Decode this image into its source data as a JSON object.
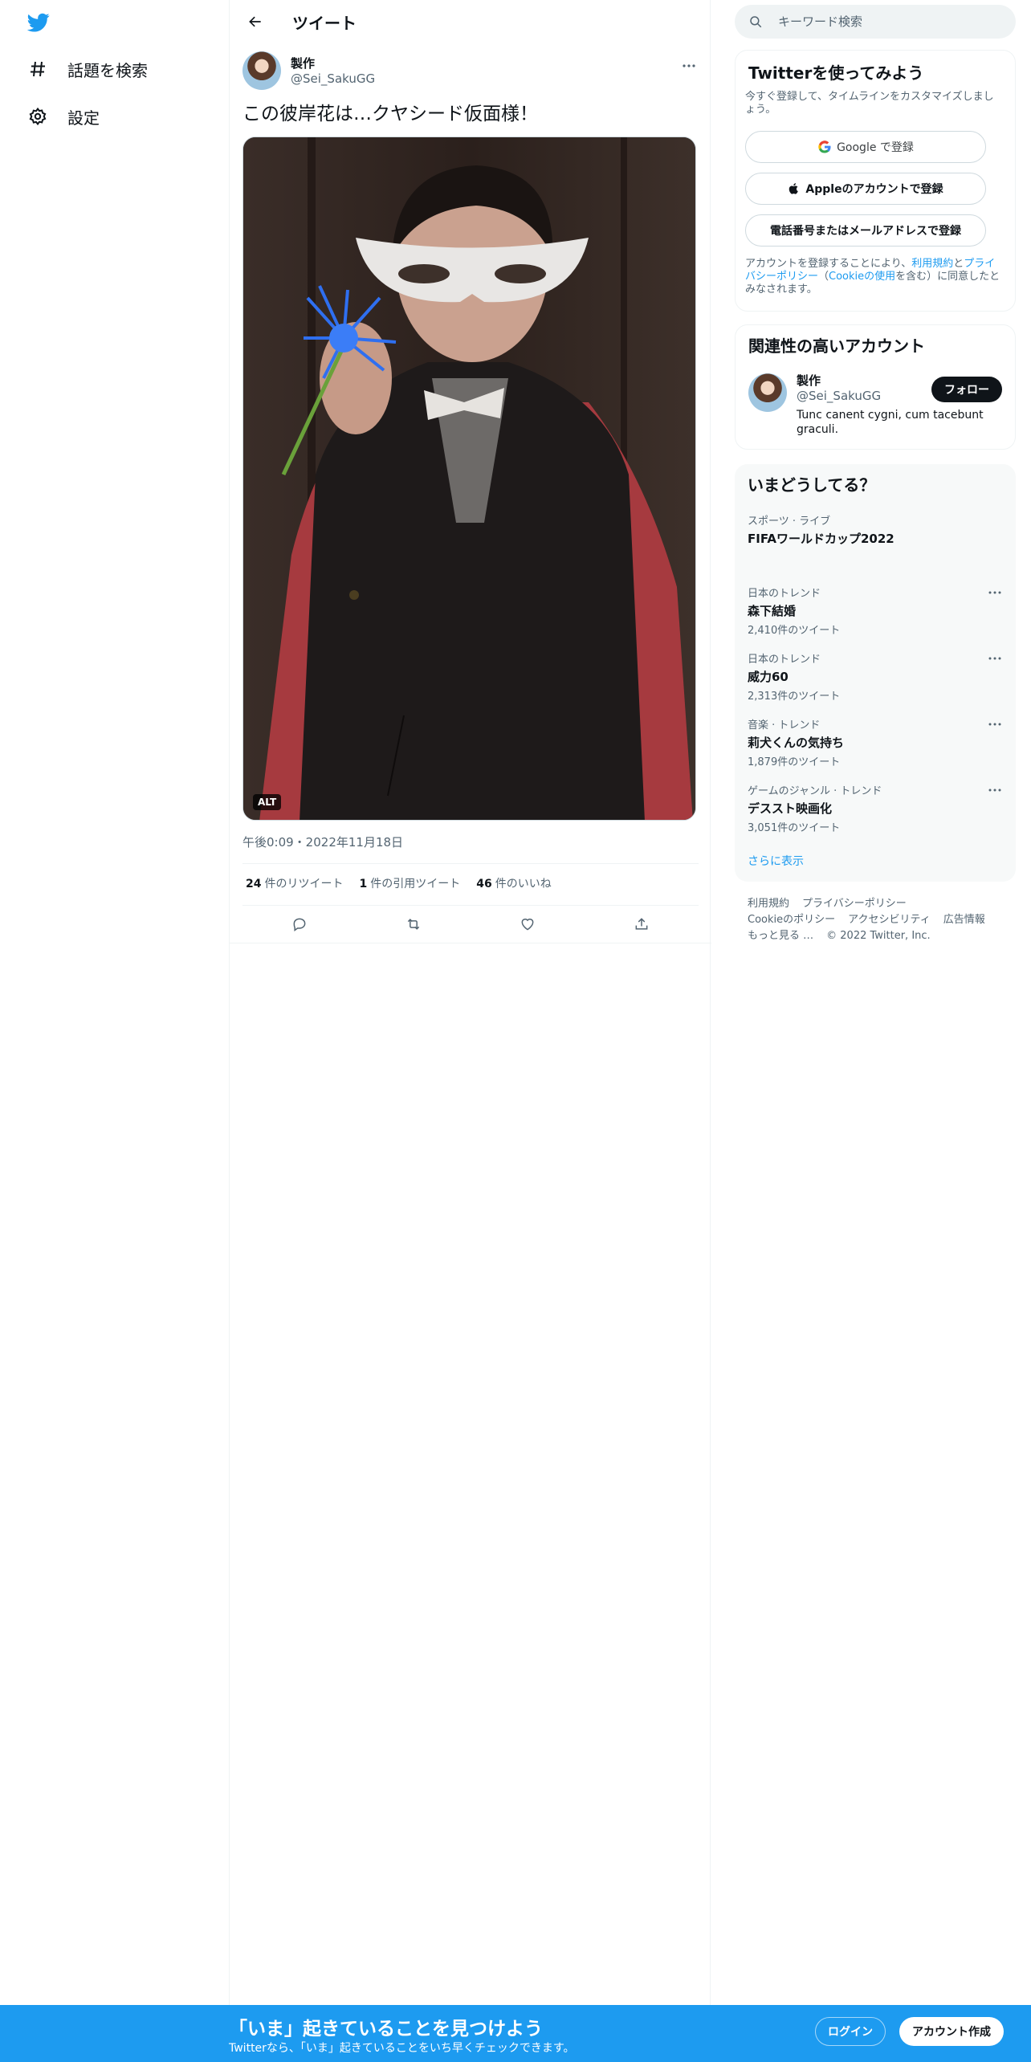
{
  "nav": {
    "items": [
      {
        "label": "話題を検索",
        "icon": "hashtag-icon"
      },
      {
        "label": "設定",
        "icon": "gear-icon"
      }
    ]
  },
  "header": {
    "title": "ツイート"
  },
  "tweet": {
    "author_name": "製作",
    "author_handle": "@Sei_SakuGG",
    "text": "この彼岸花は…クヤシード仮面様！",
    "alt_badge": "ALT",
    "timestamp": "午後0:09・2022年11月18日",
    "stats": {
      "retweets_count": "24",
      "retweets_label": "件のリツイート",
      "quotes_count": "1",
      "quotes_label": "件の引用ツイート",
      "likes_count": "46",
      "likes_label": "件のいいね"
    }
  },
  "search": {
    "placeholder": "キーワード検索"
  },
  "signup_card": {
    "title": "Twitterを使ってみよう",
    "subtitle": "今すぐ登録して、タイムラインをカスタマイズしましょう。",
    "google_button": "Google で登録",
    "apple_button": "Appleのアカウントで登録",
    "phone_button": "電話番号またはメールアドレスで登録",
    "legal_prefix": "アカウントを登録することにより、",
    "legal_terms": "利用規約",
    "legal_and": "と",
    "legal_privacy": "プライバシーポリシー",
    "legal_paren_open": "（",
    "legal_cookie": "Cookieの使用",
    "legal_suffix": "を含む）に同意したとみなされます。"
  },
  "related": {
    "title": "関連性の高いアカウント",
    "name": "製作",
    "handle": "@Sei_SakuGG",
    "bio": "Tunc canent cygni, cum tacebunt graculi.",
    "follow_button": "フォロー"
  },
  "trends": {
    "title": "いまどうしてる？",
    "items": [
      {
        "category": "スポーツ · ライブ",
        "name": "FIFAワールドカップ2022",
        "count": ""
      },
      {
        "category": "日本のトレンド",
        "name": "森下結婚",
        "count": "2,410件のツイート"
      },
      {
        "category": "日本のトレンド",
        "name": "威力60",
        "count": "2,313件のツイート"
      },
      {
        "category": "音楽 · トレンド",
        "name": "莉犬くんの気持ち",
        "count": "1,879件のツイート"
      },
      {
        "category": "ゲームのジャンル · トレンド",
        "name": "デススト映画化",
        "count": "3,051件のツイート"
      }
    ],
    "show_more": "さらに表示"
  },
  "footer": {
    "links": [
      "利用規約",
      "プライバシーポリシー",
      "Cookieのポリシー",
      "アクセシビリティ",
      "広告情報",
      "もっと見る …"
    ],
    "copyright": "© 2022 Twitter, Inc."
  },
  "banner": {
    "headline": "「いま」起きていることを見つけよう",
    "sub": "Twitterなら、「いま」起きていることをいち早くチェックできます。",
    "login": "ログイン",
    "signup": "アカウント作成"
  },
  "colors": {
    "accent": "#1d9bf0",
    "text": "#0f1419",
    "muted": "#536471"
  }
}
